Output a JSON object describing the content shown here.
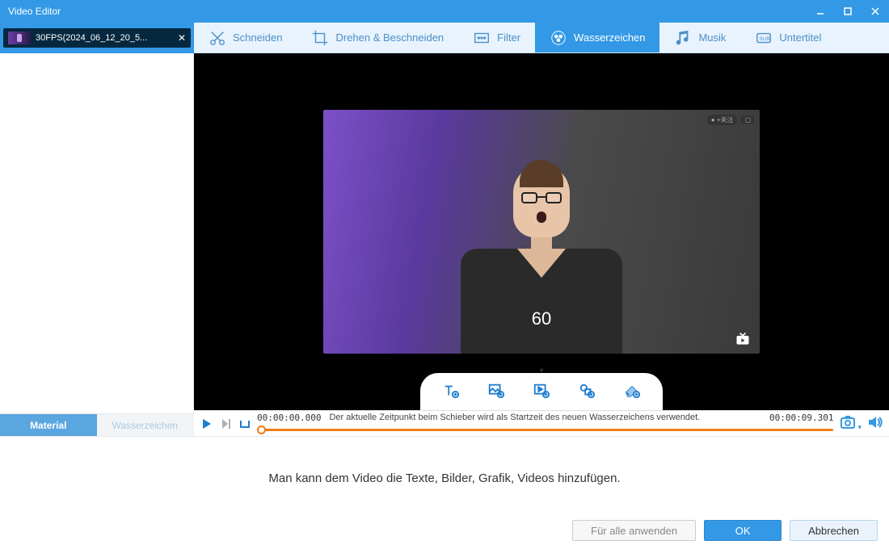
{
  "title": "Video Editor",
  "file_tab": {
    "label": "30FPS(2024_06_12_20_5..."
  },
  "toolbar": {
    "cut": "Schneiden",
    "rotate": "Drehen & Beschneiden",
    "filter": "Filter",
    "watermark": "Wasserzeichen",
    "music": "Musik",
    "subtitle": "Untertitel"
  },
  "side_tabs": {
    "material": "Material",
    "watermark": "Wasserzeichen"
  },
  "overlay_number": "60",
  "timeline": {
    "start": "00:00:00.000",
    "end": "00:00:09.301",
    "hint": "Der aktuelle Zeitpunkt beim Schieber wird als Startzeit des neuen Wasserzeichens verwendet."
  },
  "help_text": "Man kann dem Video die Texte, Bilder, Grafik, Videos hinzufügen.",
  "buttons": {
    "apply_all": "Für alle anwenden",
    "ok": "OK",
    "cancel": "Abbrechen"
  }
}
